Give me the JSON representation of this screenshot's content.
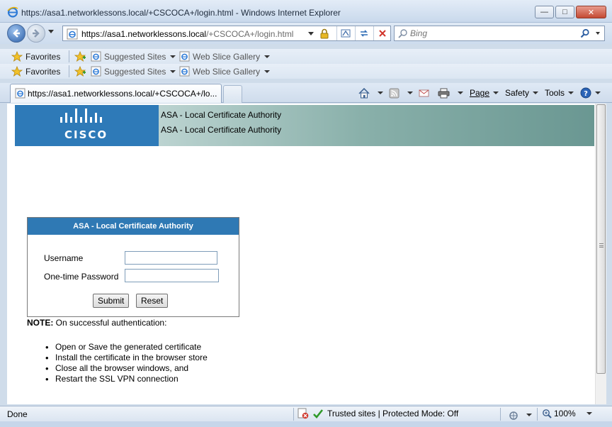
{
  "window": {
    "title": "https://asa1.networklessons.local/+CSCOCA+/login.html - Windows Internet Explorer",
    "controls": {
      "minimize": "—",
      "maximize": "□",
      "close": "✕"
    }
  },
  "address_bar": {
    "url_host": "https://asa1.networklessons.local",
    "url_path": "/+CSCOCA+/login.html"
  },
  "search": {
    "placeholder": "Bing"
  },
  "favorites_bar": {
    "rows": [
      {
        "favorites": "Favorites",
        "suggested": "Suggested Sites",
        "webslice": "Web Slice Gallery"
      },
      {
        "favorites": "Favorites",
        "suggested": "Suggested Sites",
        "webslice": "Web Slice Gallery"
      }
    ]
  },
  "tab": {
    "label": "https://asa1.networklessons.local/+CSCOCA+/lo..."
  },
  "command_bar": {
    "page": "Page",
    "safety": "Safety",
    "tools": "Tools"
  },
  "banner": {
    "logo_text": "CISCO",
    "line1": "ASA - Local Certificate Authority",
    "line2": "ASA - Local Certificate Authority"
  },
  "login": {
    "header": "ASA - Local Certificate Authority",
    "username_label": "Username",
    "username_value": "",
    "otp_label": "One-time Password",
    "otp_value": "",
    "submit": "Submit",
    "reset": "Reset"
  },
  "note": {
    "prefix": "NOTE:",
    "text": " On successful authentication:",
    "steps": [
      "Open or Save the generated certificate",
      "Install the certificate in the browser store",
      "Close all the browser windows, and",
      "Restart the SSL VPN connection"
    ]
  },
  "status_bar": {
    "status": "Done",
    "zone": "Trusted sites | Protected Mode: Off",
    "zoom": "100%"
  },
  "colors": {
    "cisco_blue": "#2e7ab8",
    "banner_teal": "#6a9792",
    "login_header": "#2f79b4"
  }
}
